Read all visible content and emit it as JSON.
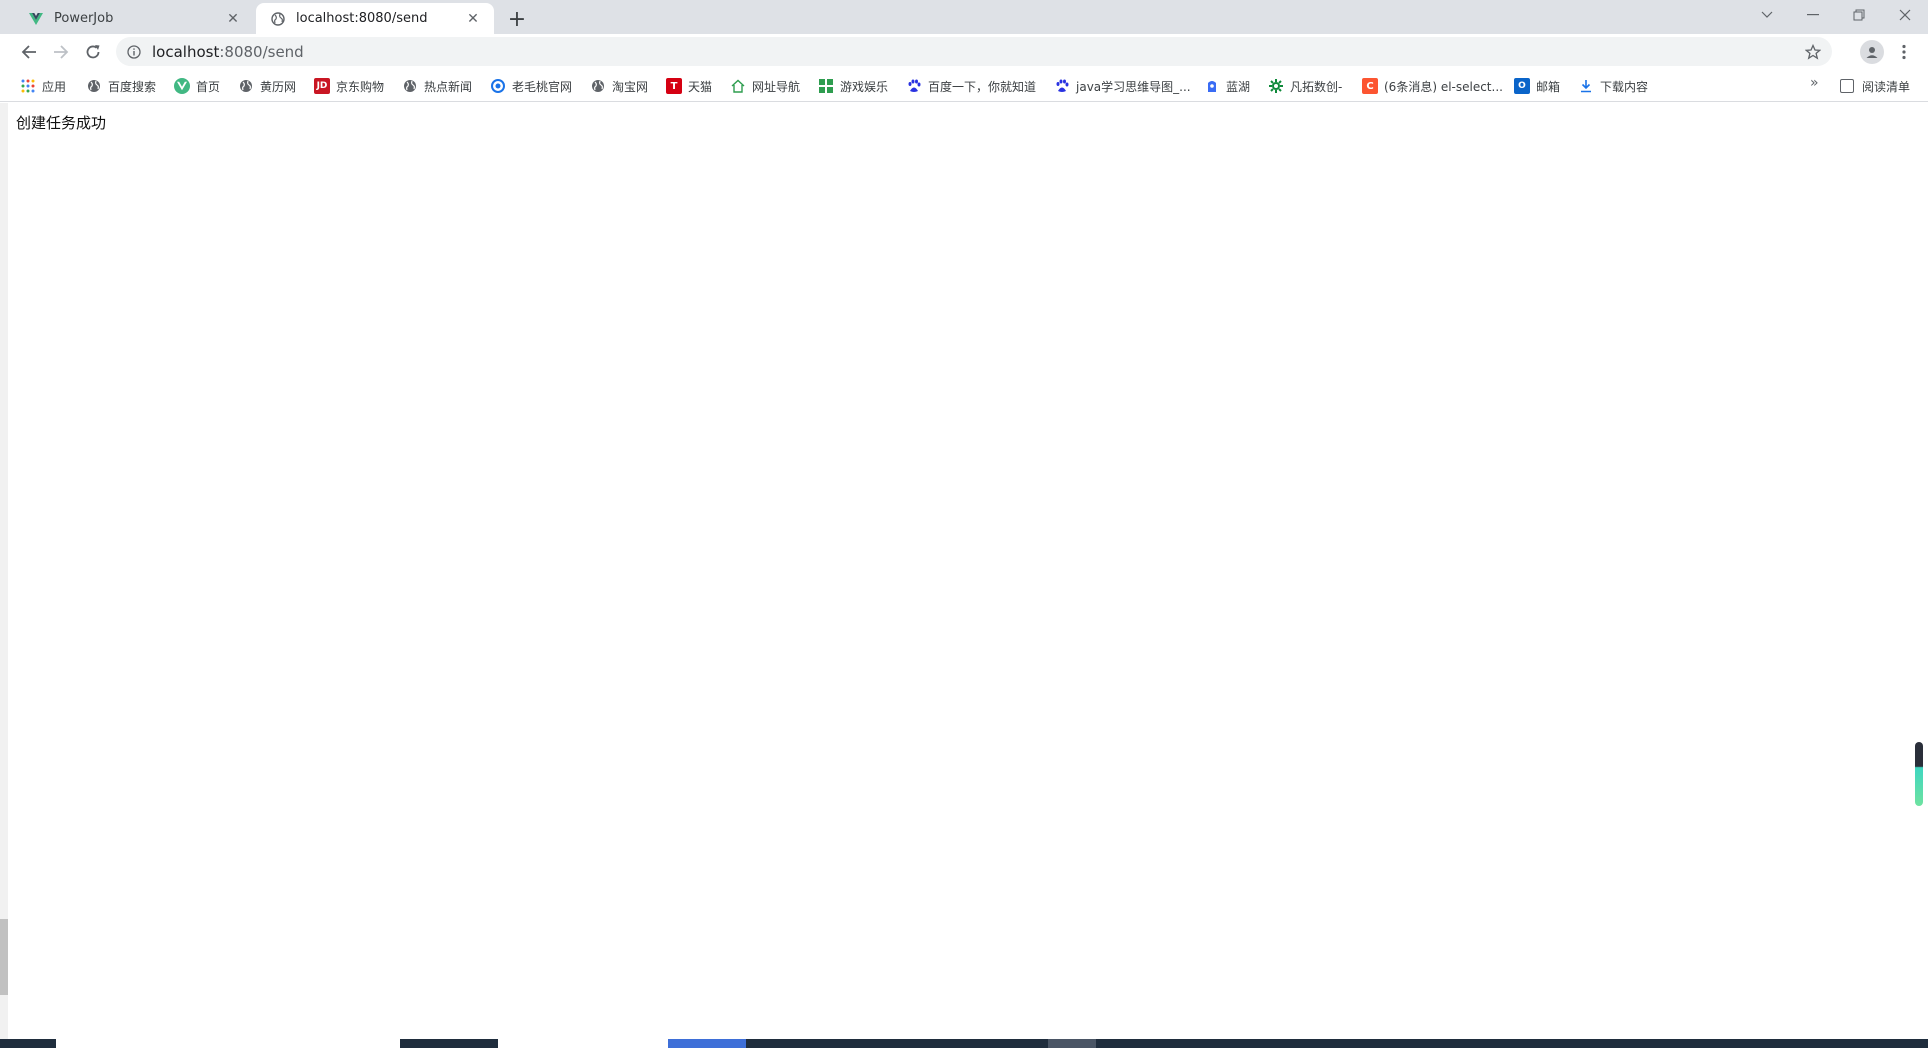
{
  "tabs": [
    {
      "title": "PowerJob",
      "favicon": "vue-logo-icon",
      "active": false
    },
    {
      "title": "localhost:8080/send",
      "favicon": "globe-icon",
      "active": true
    }
  ],
  "address": {
    "host": "localhost",
    "path": ":8080/send"
  },
  "bookmarks": [
    {
      "label": "应用",
      "icon": "apps-grid-icon"
    },
    {
      "label": "百度搜索",
      "icon": "globe-icon"
    },
    {
      "label": "首页",
      "icon": "vue-logo-icon"
    },
    {
      "label": "黄历网",
      "icon": "globe-icon"
    },
    {
      "label": "京东购物",
      "icon": "jd-icon",
      "icon_text": "JD"
    },
    {
      "label": "热点新闻",
      "icon": "globe-icon"
    },
    {
      "label": "老毛桃官网",
      "icon": "circle-icon"
    },
    {
      "label": "淘宝网",
      "icon": "globe-icon"
    },
    {
      "label": "天猫",
      "icon": "tmall-icon",
      "icon_text": "T"
    },
    {
      "label": "网址导航",
      "icon": "house-icon"
    },
    {
      "label": "游戏娱乐",
      "icon": "grid-icon"
    },
    {
      "label": "百度一下，你就知道",
      "icon": "baidu-paw-icon"
    },
    {
      "label": "java学习思维导图_...",
      "icon": "baidu-paw-icon"
    },
    {
      "label": "蓝湖",
      "icon": "lanhu-icon"
    },
    {
      "label": "凡拓数创-",
      "icon": "gear-icon"
    },
    {
      "label": "(6条消息) el-select...",
      "icon": "csdn-icon",
      "icon_text": "C"
    },
    {
      "label": "邮箱",
      "icon": "outlook-icon",
      "icon_text": "O"
    },
    {
      "label": "下载内容",
      "icon": "download-icon"
    }
  ],
  "reading_list": "阅读清单",
  "page": {
    "message": "创建任务成功"
  },
  "colors": {
    "tabstrip": "#dee1e6",
    "omnibox": "#f1f3f4",
    "jd": "#c91623",
    "tmall": "#d50012",
    "csdn": "#fc5531",
    "outlook": "#0a64c9",
    "taskbar": "#1f2d3d"
  }
}
